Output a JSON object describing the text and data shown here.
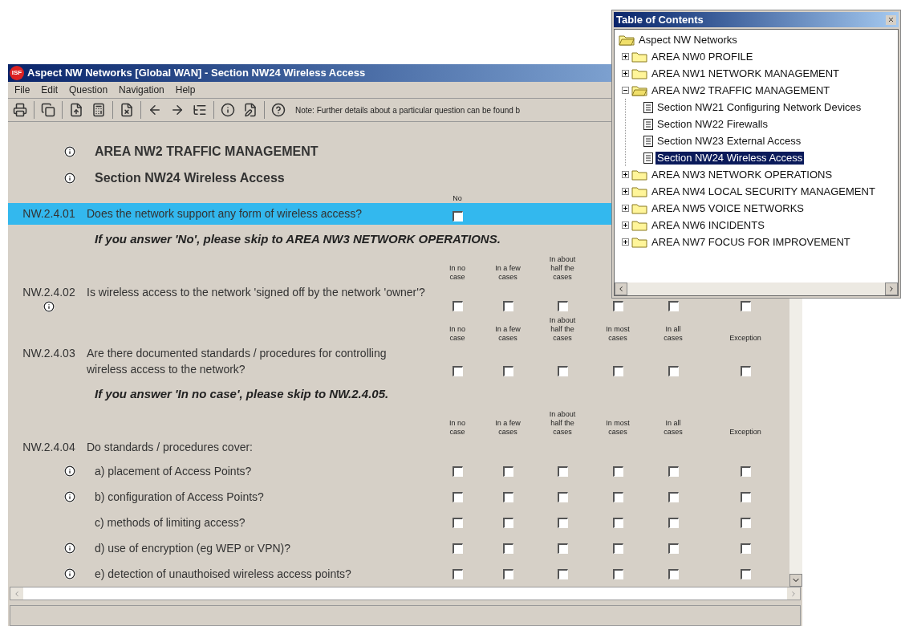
{
  "window": {
    "logo": "ISF",
    "title": "Aspect NW Networks [Global WAN] - Section NW24 Wireless Access"
  },
  "menu": [
    "File",
    "Edit",
    "Question",
    "Navigation",
    "Help"
  ],
  "toolbar_note": "Note: Further details about a particular question can be found b",
  "headings": [
    {
      "text": "AREA NW2 TRAFFIC MANAGEMENT",
      "info": true
    },
    {
      "text": "Section NW24 Wireless Access",
      "info": true
    }
  ],
  "questions": [
    {
      "number": "NW.2.4.01",
      "text": "Does the network support any form of wireless access?",
      "info": false,
      "selected": true,
      "headers": [
        "No"
      ],
      "checkboxes": [
        {
          "checked": false
        }
      ],
      "note": "If you answer 'No', please skip to AREA NW3 NETWORK OPERATIONS."
    },
    {
      "number": "NW.2.4.02",
      "text": "Is wireless access to the network 'signed off by the network 'owner'?",
      "info": true,
      "selected": false,
      "headers": [
        "In no case",
        "In a few cases",
        "In about half the cases"
      ],
      "checkboxes": [
        {
          "checked": false
        },
        {
          "checked": false
        },
        {
          "checked": false
        },
        {
          "checked": false
        },
        {
          "checked": false
        },
        {
          "checked": false
        }
      ]
    },
    {
      "number": "NW.2.4.03",
      "text": "Are there documented standards / procedures for controlling wireless access to the network?",
      "info": false,
      "selected": false,
      "headers": [
        "In no case",
        "In a few cases",
        "In about half the cases",
        "In most cases",
        "In all cases",
        "Exception"
      ],
      "checkboxes": [
        {
          "checked": false
        },
        {
          "checked": false
        },
        {
          "checked": false
        },
        {
          "checked": false
        },
        {
          "checked": false
        },
        {
          "checked": false
        }
      ],
      "note": "If you answer 'In no case', please skip to NW.2.4.05."
    },
    {
      "number": "NW.2.4.04",
      "text": "Do standards / procedures cover:",
      "info": false,
      "selected": false,
      "headers": [
        "In no case",
        "In a few cases",
        "In about half the cases",
        "In most cases",
        "In all cases",
        "Exception"
      ],
      "items": [
        {
          "label": "a) placement of Access Points?",
          "info": true,
          "checkboxes": [
            {
              "checked": false
            },
            {
              "checked": false
            },
            {
              "checked": false
            },
            {
              "checked": false
            },
            {
              "checked": false
            },
            {
              "checked": false
            }
          ]
        },
        {
          "label": "b) configuration of Access Points?",
          "info": true,
          "checkboxes": [
            {
              "checked": false
            },
            {
              "checked": false
            },
            {
              "checked": false
            },
            {
              "checked": false
            },
            {
              "checked": false
            },
            {
              "checked": false
            }
          ]
        },
        {
          "label": "c) methods of limiting access?",
          "info": false,
          "checkboxes": [
            {
              "checked": false
            },
            {
              "checked": false
            },
            {
              "checked": false
            },
            {
              "checked": false
            },
            {
              "checked": false
            },
            {
              "checked": false
            }
          ]
        },
        {
          "label": "d) use of encryption (eg WEP or VPN)?",
          "info": true,
          "checkboxes": [
            {
              "checked": false
            },
            {
              "checked": false
            },
            {
              "checked": false
            },
            {
              "checked": false
            },
            {
              "checked": false
            },
            {
              "checked": false
            }
          ]
        },
        {
          "label": "e) detection of unauthoised wireless access points?",
          "info": true,
          "checkboxes": [
            {
              "checked": false
            },
            {
              "checked": false
            },
            {
              "checked": false
            },
            {
              "checked": false
            },
            {
              "checked": false
            },
            {
              "checked": false
            }
          ]
        }
      ]
    }
  ],
  "toc": {
    "title": "Table of Contents",
    "tree": [
      {
        "label": "Aspect NW Networks",
        "kind": "root",
        "selected": false,
        "expanded": true,
        "children": [
          {
            "label": "AREA NW0 PROFILE",
            "kind": "folder",
            "selected": false,
            "expanded": false
          },
          {
            "label": "AREA NW1 NETWORK MANAGEMENT",
            "kind": "folder",
            "selected": false,
            "expanded": false
          },
          {
            "label": "AREA NW2 TRAFFIC MANAGEMENT",
            "kind": "folder",
            "selected": false,
            "expanded": true,
            "children": [
              {
                "label": "Section NW21 Configuring Network Devices",
                "kind": "section",
                "selected": false
              },
              {
                "label": "Section NW22 Firewalls",
                "kind": "section",
                "selected": false
              },
              {
                "label": "Section NW23 External Access",
                "kind": "section",
                "selected": false
              },
              {
                "label": "Section NW24 Wireless Access",
                "kind": "section",
                "selected": true
              }
            ]
          },
          {
            "label": "AREA NW3 NETWORK OPERATIONS",
            "kind": "folder",
            "selected": false,
            "expanded": false
          },
          {
            "label": "AREA NW4 LOCAL SECURITY MANAGEMENT",
            "kind": "folder",
            "selected": false,
            "expanded": false
          },
          {
            "label": "AREA NW5 VOICE NETWORKS",
            "kind": "folder",
            "selected": false,
            "expanded": false
          },
          {
            "label": "AREA NW6 INCIDENTS",
            "kind": "folder",
            "selected": false,
            "expanded": false
          },
          {
            "label": "AREA NW7 FOCUS FOR IMPROVEMENT",
            "kind": "folder",
            "selected": false,
            "expanded": false
          }
        ]
      }
    ]
  }
}
